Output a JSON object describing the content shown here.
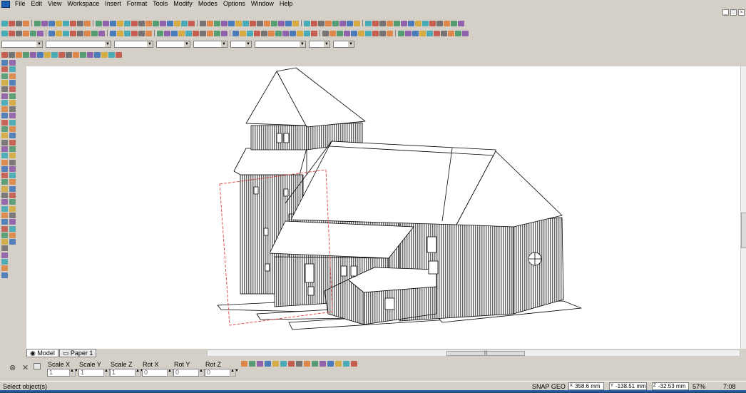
{
  "menu": [
    "File",
    "Edit",
    "View",
    "Workspace",
    "Insert",
    "Format",
    "Tools",
    "Modify",
    "Modes",
    "Options",
    "Window",
    "Help"
  ],
  "window_controls": {
    "minimize": "_",
    "restore": "□",
    "close": "×"
  },
  "tabs": [
    {
      "label": "Model",
      "icon": "model-icon"
    },
    {
      "label": "Paper 1",
      "icon": "paper-icon"
    }
  ],
  "hscroll_grip": "|||",
  "properties": {
    "scale_x": {
      "label": "Scale X",
      "value": "1"
    },
    "scale_y": {
      "label": "Scale Y",
      "value": "1"
    },
    "scale_z": {
      "label": "Scale Z",
      "value": "1"
    },
    "rot_x": {
      "label": "Rot X",
      "value": "0"
    },
    "rot_y": {
      "label": "Rot Y",
      "value": "0"
    },
    "rot_z": {
      "label": "Rot Z",
      "value": "0"
    }
  },
  "status": {
    "prompt": "Select object(s)",
    "modes": "SNAP GEO",
    "coord_x": {
      "axis": "X",
      "value": "358.6 mm"
    },
    "coord_y": {
      "axis": "Y",
      "value": "-138.51 mm"
    },
    "coord_z": {
      "axis": "Z",
      "value": "-32.53 mm"
    },
    "zoom": "57%",
    "time": "7:08"
  },
  "colors": {
    "accent": "#1f5fb4",
    "selection": "#e04040",
    "workspace_bg": "#d4d0c8"
  }
}
